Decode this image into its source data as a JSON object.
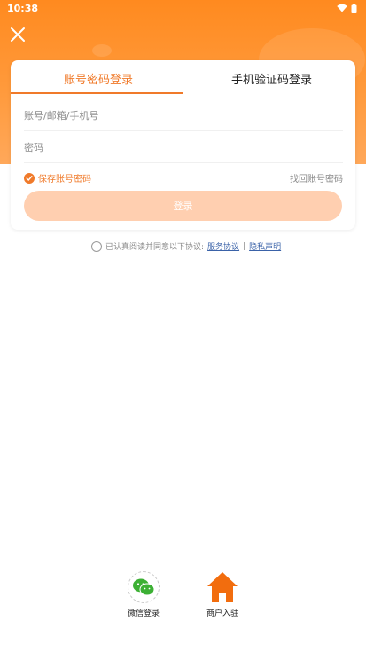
{
  "status_bar": {
    "time": "10:38"
  },
  "tabs": [
    {
      "label": "账号密码登录",
      "active": true
    },
    {
      "label": "手机验证码登录",
      "active": false
    }
  ],
  "form": {
    "account_placeholder": "账号/邮箱/手机号",
    "password_placeholder": "密码",
    "remember_label": "保存账号密码",
    "remember_checked": true,
    "forgot_label": "找回账号密码",
    "login_label": "登录"
  },
  "agreement": {
    "text": "已认真阅读并同意以下协议:",
    "service_link": "服务协议",
    "separator": "|",
    "privacy_link": "隐私声明"
  },
  "bottom": {
    "wechat_label": "微信登录",
    "merchant_label": "商户入驻"
  },
  "colors": {
    "accent": "#f07a2a",
    "header": "#ff8a1f",
    "login_button": "#ffcfb0",
    "wechat": "#3cb034",
    "link": "#3a62a8"
  },
  "icons": [
    "close-icon",
    "wifi-icon",
    "battery-icon",
    "check-icon",
    "wechat-icon",
    "home-icon"
  ]
}
